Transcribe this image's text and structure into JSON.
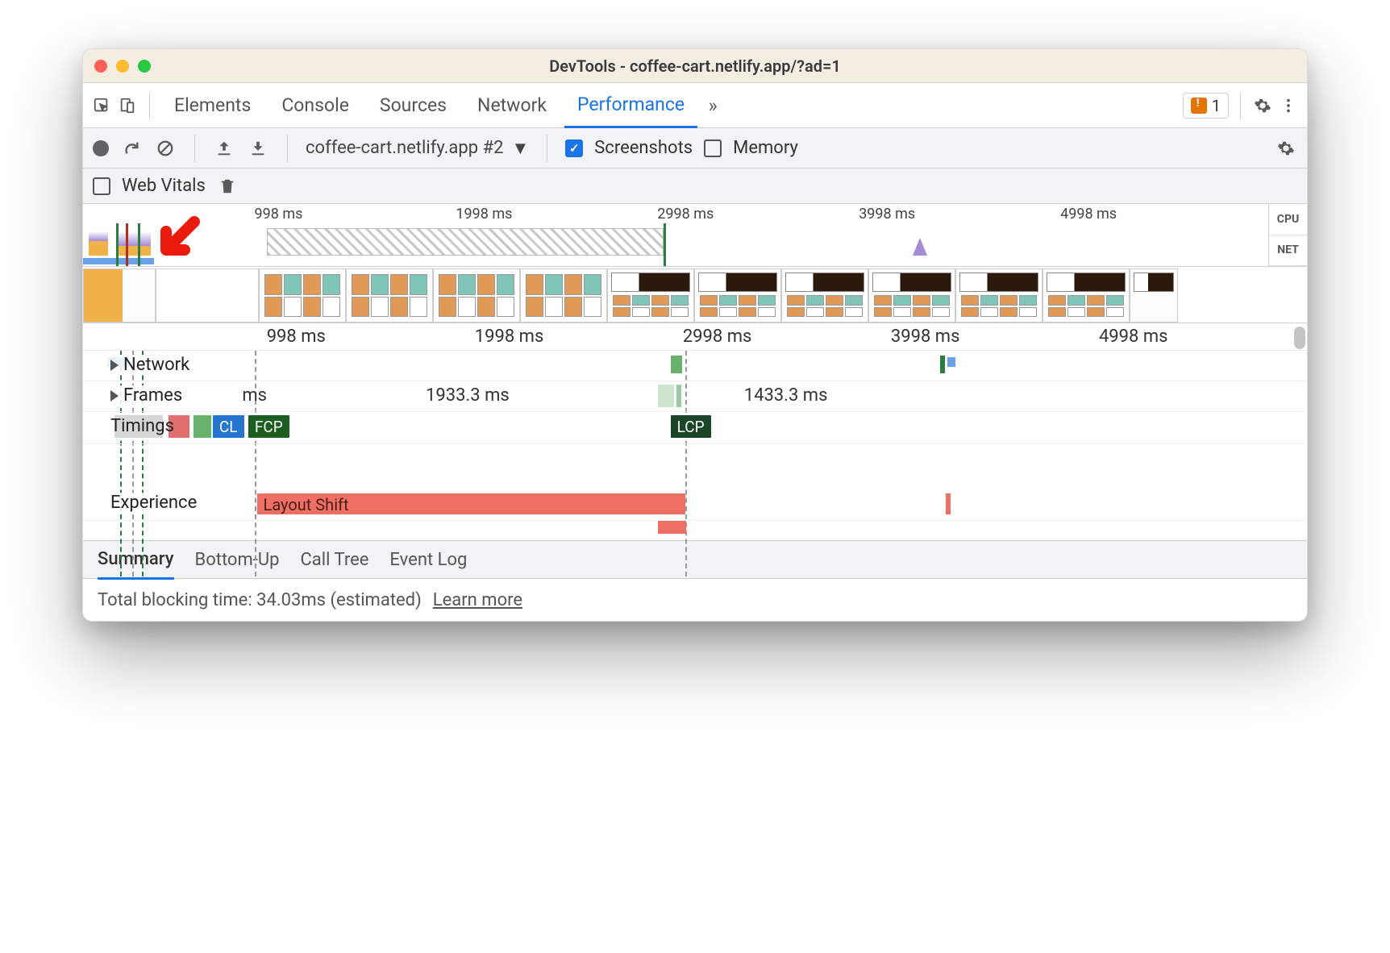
{
  "window": {
    "title": "DevTools - coffee-cart.netlify.app/?ad=1"
  },
  "traffic": {
    "close": "#ff5f57",
    "min": "#febc2e",
    "max": "#28c840"
  },
  "main_tabs": [
    "Elements",
    "Console",
    "Sources",
    "Network",
    "Performance"
  ],
  "main_tabs_active": 4,
  "issues": {
    "count": "1"
  },
  "toolbar": {
    "profile_name": "coffee-cart.netlify.app #2",
    "screenshots_label": "Screenshots",
    "screenshots_checked": true,
    "memory_label": "Memory",
    "memory_checked": false
  },
  "toolbar2": {
    "web_vitals_label": "Web Vitals",
    "web_vitals_checked": false
  },
  "overview_ruler": [
    "998 ms",
    "1998 ms",
    "2998 ms",
    "3998 ms",
    "4998 ms"
  ],
  "overview_side": {
    "cpu": "CPU",
    "net": "NET"
  },
  "track_ruler": [
    "998 ms",
    "1998 ms",
    "2998 ms",
    "3998 ms",
    "4998 ms"
  ],
  "tracks": {
    "network_label": "Network",
    "frames_label": "Frames",
    "frames_values": [
      {
        "text_suffix": " ms",
        "left_pct": 13
      },
      {
        "text": "1933.3 ms",
        "left_pct": 28
      },
      {
        "text": "1433.3 ms",
        "left_pct": 54
      }
    ],
    "timings_label": "Timings",
    "timings_badges": {
      "cl": "CL",
      "fcp": "FCP",
      "lcp": "LCP"
    },
    "experience_label": "Experience",
    "layout_shift_label": "Layout Shift"
  },
  "bottom_tabs": [
    "Summary",
    "Bottom-Up",
    "Call Tree",
    "Event Log"
  ],
  "bottom_active": 0,
  "summary": {
    "tbt_text": "Total blocking time: 34.03ms (estimated)",
    "learn_more": "Learn more"
  },
  "colors": {
    "cl_badge": "#2574cf",
    "fcp_badge": "#1b5e20",
    "lcp_badge": "#1b4527",
    "layout_shift": "#ee6f63",
    "annotation_arrow": "#ea1b0c"
  }
}
